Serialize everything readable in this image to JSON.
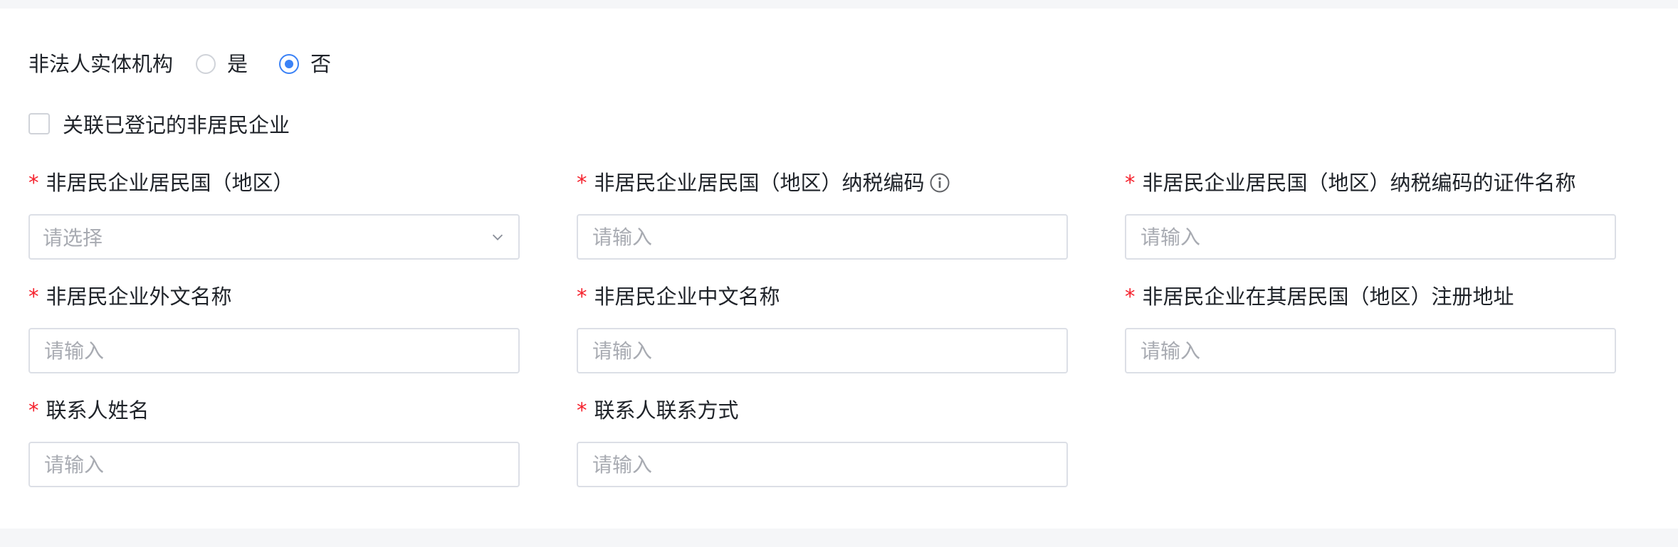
{
  "entity": {
    "label": "非法人实体机构",
    "options": [
      {
        "label": "是",
        "checked": false
      },
      {
        "label": "否",
        "checked": true
      }
    ]
  },
  "link_checkbox": {
    "label": "关联已登记的非居民企业",
    "checked": false
  },
  "fields": {
    "country": {
      "label": "非居民企业居民国（地区）",
      "placeholder": "请选择",
      "required": true,
      "type": "select"
    },
    "tax_code": {
      "label": "非居民企业居民国（地区）纳税编码",
      "placeholder": "请输入",
      "required": true,
      "has_info_icon": true
    },
    "tax_code_cert": {
      "label": "非居民企业居民国（地区）纳税编码的证件名称",
      "placeholder": "请输入",
      "required": true
    },
    "foreign_name": {
      "label": "非居民企业外文名称",
      "placeholder": "请输入",
      "required": true
    },
    "chinese_name": {
      "label": "非居民企业中文名称",
      "placeholder": "请输入",
      "required": true
    },
    "reg_address": {
      "label": "非居民企业在其居民国（地区）注册地址",
      "placeholder": "请输入",
      "required": true
    },
    "contact_name": {
      "label": "联系人姓名",
      "placeholder": "请输入",
      "required": true
    },
    "contact_method": {
      "label": "联系人联系方式",
      "placeholder": "请输入",
      "required": true
    }
  },
  "required_mark": "*",
  "colors": {
    "accent": "#3b82f6",
    "required": "#f5222d",
    "border": "#dcdfe6",
    "placeholder": "#a8abb2"
  }
}
